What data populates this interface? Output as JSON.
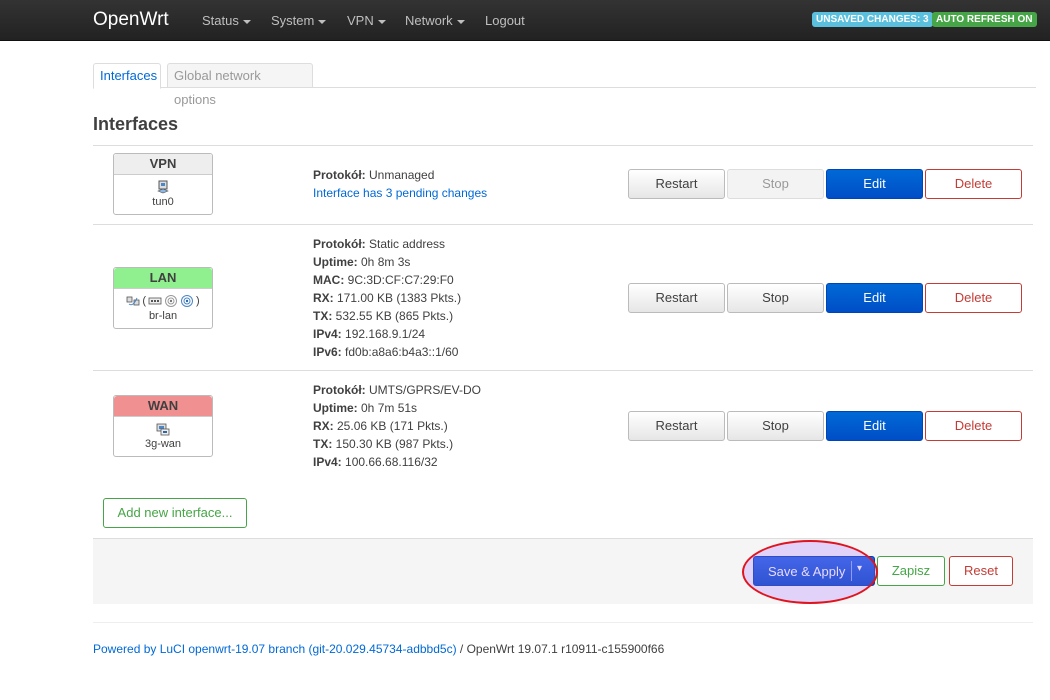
{
  "navbar": {
    "brand": "OpenWrt",
    "menu": [
      {
        "label": "Status"
      },
      {
        "label": "System"
      },
      {
        "label": "VPN"
      },
      {
        "label": "Network"
      },
      {
        "label": "Logout"
      }
    ],
    "unsaved_badge": "UNSAVED CHANGES: 3",
    "refresh_badge": "AUTO REFRESH ON",
    "colors": {
      "unsaved": "#5bc0de",
      "refresh": "#46a546"
    }
  },
  "tabs": [
    {
      "label": "Interfaces",
      "active": true
    },
    {
      "label": "Global network options",
      "active": false
    }
  ],
  "page_title": "Interfaces",
  "interfaces": [
    {
      "name": "VPN",
      "device": "tun0",
      "header_color": "#eeeeee",
      "icons": [
        "network-device-icon"
      ],
      "info": [
        {
          "key": "Protokół:",
          "value": " Unmanaged"
        }
      ],
      "pending": "Interface has 3 pending changes",
      "buttons": {
        "restart": "Restart",
        "stop": "Stop",
        "edit": "Edit",
        "delete": "Delete"
      },
      "stop_disabled": true
    },
    {
      "name": "LAN",
      "device": "br-lan",
      "header_color": "#90f090",
      "icons": [
        "bridge-icon",
        "switch-icon",
        "wifi-icon",
        "wifi-icon"
      ],
      "info": [
        {
          "key": "Protokół:",
          "value": " Static address"
        },
        {
          "key": "Uptime:",
          "value": " 0h 8m 3s"
        },
        {
          "key": "MAC:",
          "value": " 9C:3D:CF:C7:29:F0"
        },
        {
          "key": "RX:",
          "value": " 171.00 KB (1383 Pkts.)"
        },
        {
          "key": "TX:",
          "value": " 532.55 KB (865 Pkts.)"
        },
        {
          "key": "IPv4:",
          "value": " 192.168.9.1/24"
        },
        {
          "key": "IPv6:",
          "value": " fd0b:a8a6:b4a3::1/60"
        }
      ],
      "buttons": {
        "restart": "Restart",
        "stop": "Stop",
        "edit": "Edit",
        "delete": "Delete"
      },
      "stop_disabled": false
    },
    {
      "name": "WAN",
      "device": "3g-wan",
      "header_color": "#f09090",
      "icons": [
        "modem-icon"
      ],
      "info": [
        {
          "key": "Protokół:",
          "value": " UMTS/GPRS/EV-DO"
        },
        {
          "key": "Uptime:",
          "value": " 0h 7m 51s"
        },
        {
          "key": "RX:",
          "value": " 25.06 KB (171 Pkts.)"
        },
        {
          "key": "TX:",
          "value": " 150.30 KB (987 Pkts.)"
        },
        {
          "key": "IPv4:",
          "value": " 100.66.68.116/32"
        }
      ],
      "buttons": {
        "restart": "Restart",
        "stop": "Stop",
        "edit": "Edit",
        "delete": "Delete"
      },
      "stop_disabled": false
    }
  ],
  "add_interface_label": "Add new interface...",
  "actions": {
    "save_apply": "Save & Apply",
    "dropdown_arrow": "▾",
    "zapisz": "Zapisz",
    "reset": "Reset"
  },
  "footer": {
    "link": "Powered by LuCI openwrt-19.07 branch (git-20.029.45734-adbbd5c)",
    "text": " / OpenWrt 19.07.1 r10911-c155900f66"
  }
}
